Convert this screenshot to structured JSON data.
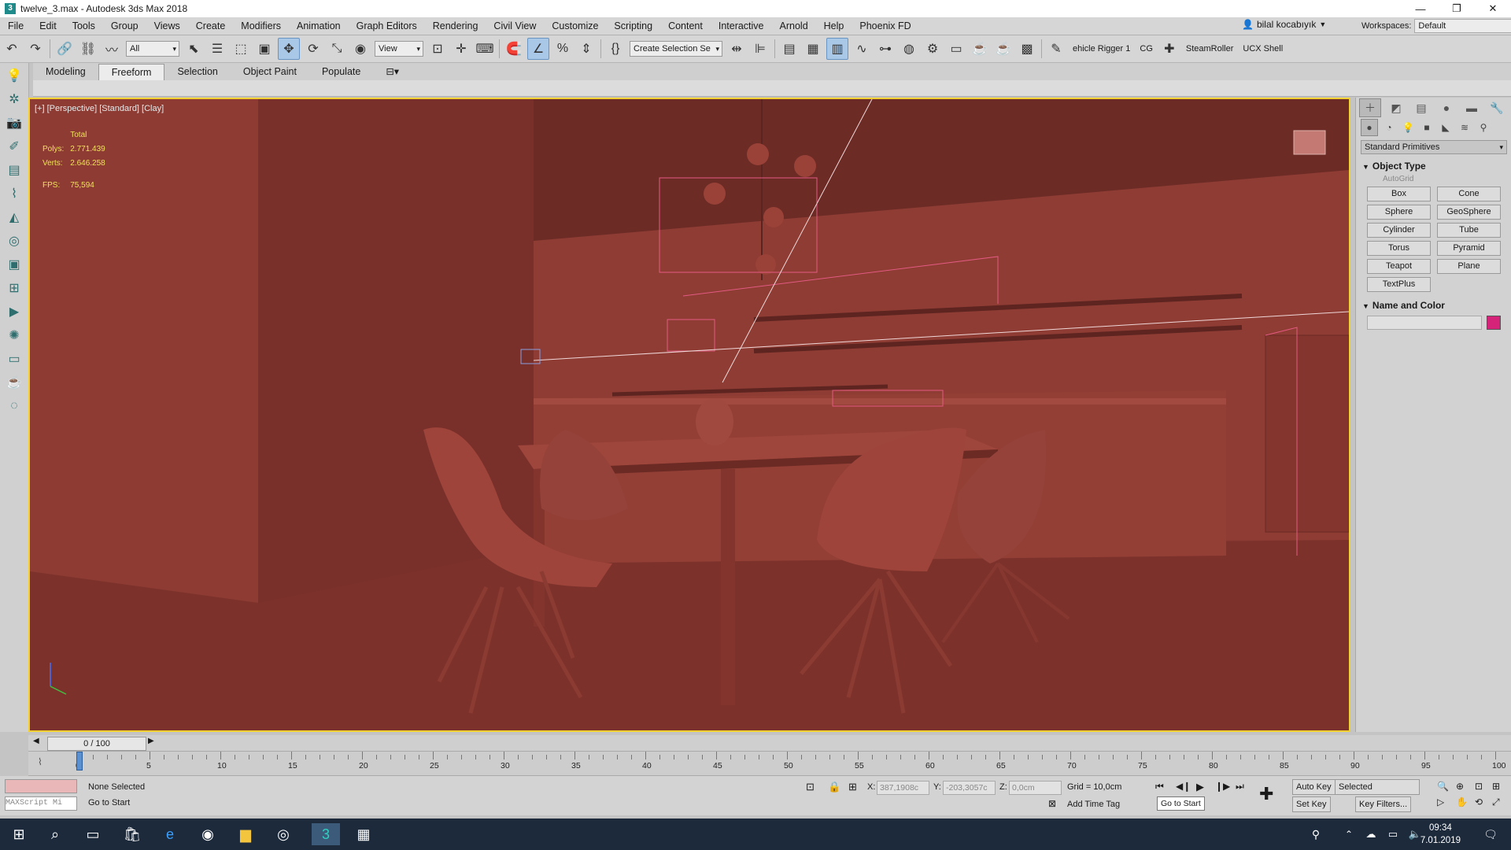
{
  "window": {
    "title": "twelve_3.max - Autodesk 3ds Max 2018",
    "app_icon": "3",
    "min": "—",
    "max": "❐",
    "close": "✕"
  },
  "menu": {
    "items": [
      "File",
      "Edit",
      "Tools",
      "Group",
      "Views",
      "Create",
      "Modifiers",
      "Animation",
      "Graph Editors",
      "Rendering",
      "Civil View",
      "Customize",
      "Scripting",
      "Content",
      "Interactive",
      "Arnold",
      "Help",
      "Phoenix FD"
    ],
    "user": "bilal kocabıyık",
    "workspaces_label": "Workspaces:",
    "workspace_value": "Default"
  },
  "toolbar": {
    "filter_value": "All",
    "refcoord_value": "View",
    "selection_set": "Create Selection Se",
    "vehicle_rigger": "ehicle Rigger 1",
    "cg": "CG",
    "steamroller": "SteamRoller",
    "ucx": "UCX Shell"
  },
  "ribbon": {
    "tabs": [
      "Modeling",
      "Freeform",
      "Selection",
      "Object Paint",
      "Populate"
    ],
    "active": "Freeform"
  },
  "viewport": {
    "label": "[+] [Perspective] [Standard] [Clay]",
    "stats_header": "Total",
    "polys_label": "Polys:",
    "polys": "2.771.439",
    "verts_label": "Verts:",
    "verts": "2.646.258",
    "fps_label": "FPS:",
    "fps": "75,594",
    "clay_color": "#8a3a33"
  },
  "command_panel": {
    "dropdown": "Standard Primitives",
    "object_type": "Object Type",
    "autogrid": "AutoGrid",
    "primitives": [
      "Box",
      "Cone",
      "Sphere",
      "GeoSphere",
      "Cylinder",
      "Tube",
      "Torus",
      "Pyramid",
      "Teapot",
      "Plane",
      "TextPlus"
    ],
    "name_and_color": "Name and Color",
    "swatch_color": "#d6237a"
  },
  "timeline": {
    "frame_display": "0 / 100",
    "ticks": [
      "0",
      "5",
      "10",
      "15",
      "20",
      "25",
      "30",
      "35",
      "40",
      "45",
      "50",
      "55",
      "60",
      "65",
      "70",
      "75",
      "80",
      "85",
      "90",
      "95",
      "100"
    ]
  },
  "status": {
    "selection": "None Selected",
    "prompt": "Go to Start",
    "maxscript": "MAXScript Mi",
    "x_label": "X:",
    "x_val": "387,1908c",
    "y_label": "Y:",
    "y_val": "-203,3057c",
    "z_label": "Z:",
    "z_val": "0,0cm",
    "grid": "Grid = 10,0cm",
    "add_time_tag": "Add Time Tag",
    "tooltip": "Go to Start",
    "auto_key": "Auto Key",
    "set_key": "Set Key",
    "selected": "Selected",
    "key_filters": "Key Filters..."
  },
  "taskbar": {
    "time": "09:34",
    "date": "7.01.2019"
  }
}
